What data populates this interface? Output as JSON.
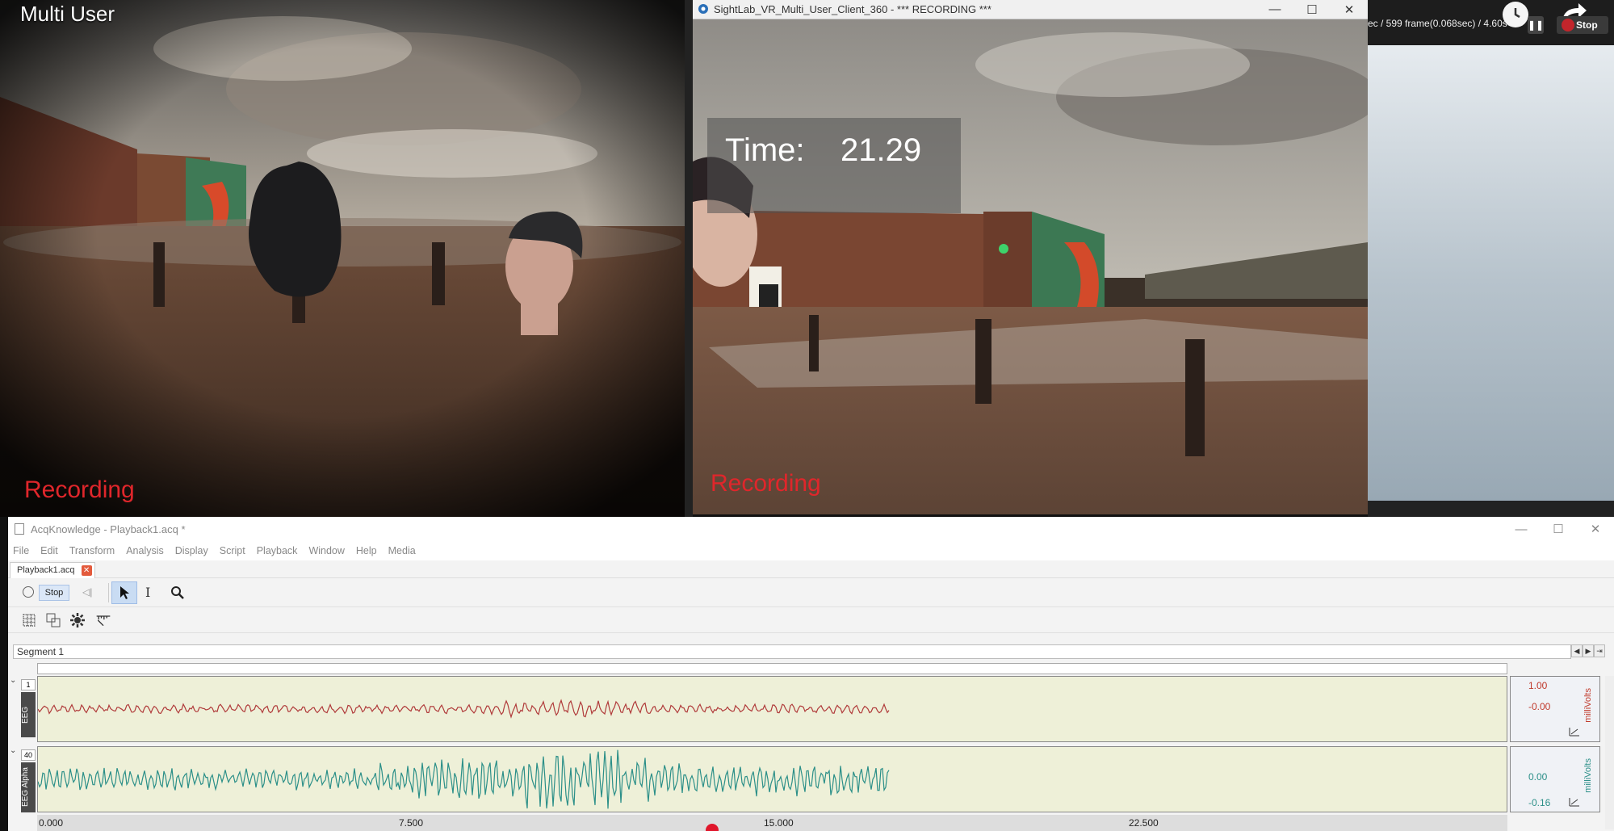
{
  "left_view": {
    "title": "Multi User",
    "recording_label": "Recording"
  },
  "client_window": {
    "title": "SightLab_VR_Multi_User_Client_360 - *** RECORDING ***",
    "time_label": "Time:",
    "time_value": "21.29",
    "recording_label": "Recording",
    "min": "—",
    "max": "☐",
    "close": "✕"
  },
  "recorder": {
    "status_text": "ec / 599 frame(0.068sec) / 4.60s",
    "pause_label": "❚❚",
    "stop_label": "Stop"
  },
  "acq": {
    "title": "AcqKnowledge - Playback1.acq *",
    "min": "—",
    "max": "☐",
    "close": "✕",
    "menu": [
      "File",
      "Edit",
      "Transform",
      "Analysis",
      "Display",
      "Script",
      "Playback",
      "Window",
      "Help",
      "Media"
    ],
    "tab_label": "Playback1.acq",
    "tab_close": "✕",
    "stop_label": "Stop",
    "rewind_label": "◁|",
    "ibeam_label": "I",
    "segment_label": "Segment 1",
    "seg_nav": [
      "◀",
      "▶",
      "⇥"
    ],
    "channels": [
      {
        "num": "1",
        "name": "EEG",
        "scale_hi": "1.00",
        "scale_lo": "-0.00",
        "unit": "milliVolts",
        "color": "#b03a3a",
        "expand": "⌄"
      },
      {
        "num": "40",
        "name": "EEG Alpha",
        "scale_hi": "0.00",
        "scale_lo": "-0.16",
        "unit": "milliVolts",
        "color": "#2b8f88",
        "expand": "⌄"
      }
    ],
    "x_ticks": [
      "0.000",
      "7.500",
      "15.000",
      "22.500"
    ]
  },
  "colors": {
    "recording": "#e0262b",
    "eeg_trace": "#b03a3a",
    "alpha_trace": "#2b8f88",
    "channel_bg": "#eef0d8"
  }
}
